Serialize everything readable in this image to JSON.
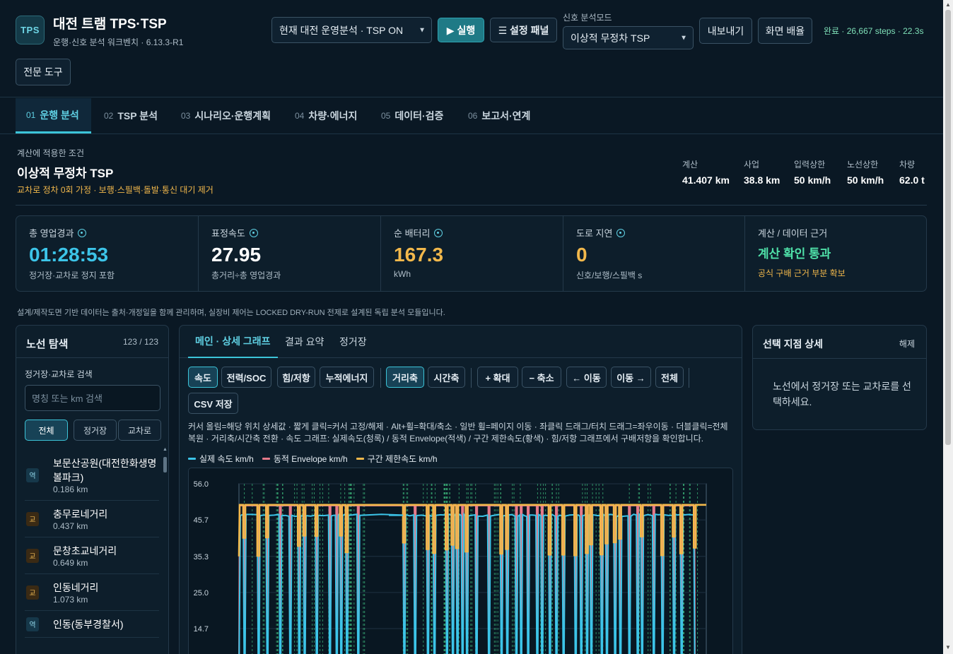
{
  "app": {
    "logo": "TPS",
    "title": "대전 트램 TPS·TSP",
    "subtitle": "운행·신호 분석 워크벤치 · 6.13.3-R1"
  },
  "toolbar": {
    "scenario_select": "현재 대전 운영분석 · TSP ON",
    "run_label": "▶ 실행",
    "settings_label": "☰ 설정 패널",
    "signal_mode_label": "신호 분석모드",
    "signal_mode_select": "이상적 무정차 TSP",
    "export_label": "내보내기",
    "layout_label": "화면 배율",
    "expert_label": "전문 도구",
    "status": "완료 · 26,667 steps · 22.3s"
  },
  "tabs": [
    {
      "num": "01",
      "label": "운행 분석",
      "active": true
    },
    {
      "num": "02",
      "label": "TSP 분석",
      "active": false
    },
    {
      "num": "03",
      "label": "시나리오·운행계획",
      "active": false
    },
    {
      "num": "04",
      "label": "차량·에너지",
      "active": false
    },
    {
      "num": "05",
      "label": "데이터·검증",
      "active": false
    },
    {
      "num": "06",
      "label": "보고서·연계",
      "active": false
    }
  ],
  "condition": {
    "label": "계산에 적용한 조건",
    "title": "이상적 무정차 TSP",
    "desc": "교차로 정차 0회 가정 · 보행·스필백·돌발·통신 대기 제거",
    "specs": [
      {
        "k": "계산",
        "v": "41.407 km"
      },
      {
        "k": "사업",
        "v": "38.8 km"
      },
      {
        "k": "입력상한",
        "v": "50 km/h"
      },
      {
        "k": "노선상한",
        "v": "50 km/h"
      },
      {
        "k": "차량",
        "v": "62.0 t"
      }
    ]
  },
  "kpis": [
    {
      "k": "총 영업경과",
      "v": "01:28:53",
      "s": "정거장·교차로 정지 포함",
      "color": "#3cc4e8",
      "info": true
    },
    {
      "k": "표정속도",
      "v": "27.95",
      "s": "총거리÷총 영업경과",
      "color": "#ffffff",
      "info": true
    },
    {
      "k": "순 배터리",
      "v": "167.3",
      "s": "kWh",
      "color": "#f2b84b",
      "info": true
    },
    {
      "k": "도로 지연",
      "v": "0",
      "s": "신호/보행/스필백 s",
      "color": "#f2b84b",
      "info": true
    },
    {
      "k": "계산 / 데이터 근거",
      "v": "계산 확인 통과",
      "s": "공식 구배 근거 부분 확보",
      "color": "#4fe0a8",
      "info": false
    }
  ],
  "note": "설계/제작도면 기반 데이터는 출처·개정일을 함께 관리하며, 실장비 제어는 LOCKED DRY-RUN 전제로 설계된 독립 분석 모듈입니다.",
  "route_panel": {
    "title": "노선 탐색",
    "count": "123 / 123",
    "search_label": "정거장·교차로 검색",
    "search_placeholder": "명칭 또는 km 검색",
    "filters": [
      "전체",
      "정거장",
      "교차로"
    ],
    "items": [
      {
        "badge": "역",
        "type": "station",
        "name": "보문산공원(대전한화생명볼파크)",
        "km": "0.186 km"
      },
      {
        "badge": "교",
        "type": "inter",
        "name": "충무로네거리",
        "km": "0.437 km"
      },
      {
        "badge": "교",
        "type": "inter",
        "name": "문창초교네거리",
        "km": "0.649 km"
      },
      {
        "badge": "교",
        "type": "inter",
        "name": "인동네거리",
        "km": "1.073 km"
      },
      {
        "badge": "역",
        "type": "station",
        "name": "인동(동부경찰서)",
        "km": ""
      }
    ]
  },
  "main_panel": {
    "tabs": [
      "메인 · 상세 그래프",
      "결과 요약",
      "정거장"
    ],
    "tools": {
      "speed": "속도",
      "power": "전력/SOC",
      "force": "힘/저항",
      "energy": "누적에너지",
      "distance": "거리축",
      "time": "시간축",
      "zoom_in": "+ 확대",
      "zoom_out": "− 축소",
      "left": "← 이동",
      "right": "이동 →",
      "all": "전체",
      "csv": "CSV 저장"
    },
    "help": "커서 올림=해당 위치 상세값 · 짧게 클릭=커서 고정/해제 · Alt+휠=확대/축소 · 일반 휠=페이지 이동 · 좌클릭 드래그/터치 드래그=좌우이동 · 더블클릭=전체복원 · 거리축/시간축 전환 · 속도 그래프: 실제속도(청록) / 동적 Envelope(적색) / 구간 제한속도(황색) · 힘/저항 그래프에서 구배저항을 확인합니다.",
    "legend": [
      {
        "name": "실제 속도 km/h",
        "color": "#3cc4e8"
      },
      {
        "name": "동적 Envelope km/h",
        "color": "#e57a8a"
      },
      {
        "name": "구간 제한속도 km/h",
        "color": "#f2b84b"
      }
    ]
  },
  "chart_data": {
    "type": "line",
    "y_ticks": [
      "56.0",
      "45.7",
      "35.3",
      "25.0",
      "14.7"
    ],
    "ylim": [
      0,
      56
    ],
    "xlim": [
      0,
      41.407
    ],
    "x_unit": "km",
    "series": [
      {
        "name": "실제 속도 km/h",
        "color": "#3cc4e8"
      },
      {
        "name": "동적 Envelope km/h",
        "color": "#e57a8a"
      },
      {
        "name": "구간 제한속도 km/h",
        "color": "#f2b84b"
      }
    ]
  },
  "detail_panel": {
    "title": "선택 지점 상세",
    "clear": "해제",
    "body": "노선에서 정거장 또는 교차로를 선택하세요."
  }
}
